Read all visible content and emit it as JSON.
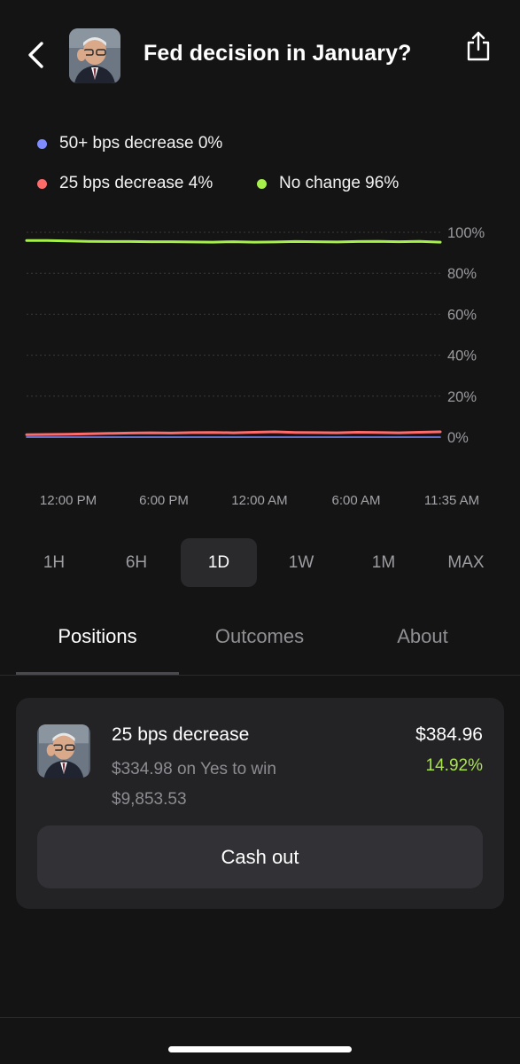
{
  "header": {
    "title": "Fed decision in January?",
    "back_icon": "chevron-left-icon",
    "share_icon": "share-icon"
  },
  "legend": [
    {
      "label": "50+ bps decrease 0%",
      "color": "#7f8cff"
    },
    {
      "label": "25 bps decrease 4%",
      "color": "#ff6b6b"
    },
    {
      "label": "No change 96%",
      "color": "#a6f04a"
    }
  ],
  "chart_data": {
    "type": "line",
    "y_tick_labels": [
      "100%",
      "80%",
      "60%",
      "40%",
      "20%",
      "0%"
    ],
    "x_tick_labels": [
      "12:00 PM",
      "6:00 PM",
      "12:00 AM",
      "6:00 AM",
      "11:35 AM"
    ],
    "ylim": [
      0,
      100
    ],
    "grid": true,
    "series": [
      {
        "name": "No change",
        "color": "#a6f04a",
        "values": [
          96,
          96,
          95.8,
          95.6,
          95.5,
          95.5,
          95.4,
          95.4,
          95.3,
          95.2,
          95.4,
          95.2,
          95.3,
          95.5,
          95.4,
          95.3,
          95.5,
          95.6,
          95.4,
          95.6,
          95.2
        ]
      },
      {
        "name": "25 bps decrease",
        "color": "#ff6b6b",
        "values": [
          1.2,
          1.3,
          1.4,
          1.6,
          1.8,
          2.0,
          2.1,
          2.0,
          2.2,
          2.3,
          2.1,
          2.4,
          2.6,
          2.3,
          2.2,
          2.1,
          2.4,
          2.3,
          2.1,
          2.4,
          2.6
        ]
      },
      {
        "name": "50+ bps decrease",
        "color": "#7f8cff",
        "values": [
          0,
          0,
          0,
          0,
          0,
          0,
          0,
          0,
          0,
          0,
          0,
          0,
          0,
          0,
          0,
          0,
          0,
          0,
          0,
          0,
          0
        ]
      }
    ]
  },
  "timeframes": [
    {
      "label": "1H"
    },
    {
      "label": "6H"
    },
    {
      "label": "1D"
    },
    {
      "label": "1W"
    },
    {
      "label": "1M"
    },
    {
      "label": "MAX"
    }
  ],
  "active_timeframe": "1D",
  "tabs": [
    {
      "label": "Positions"
    },
    {
      "label": "Outcomes"
    },
    {
      "label": "About"
    }
  ],
  "active_tab": "Positions",
  "position": {
    "name": "25 bps decrease",
    "detail": "$334.98 on Yes to win $9,853.53",
    "value": "$384.96",
    "change": "14.92%",
    "cashout_label": "Cash out"
  }
}
